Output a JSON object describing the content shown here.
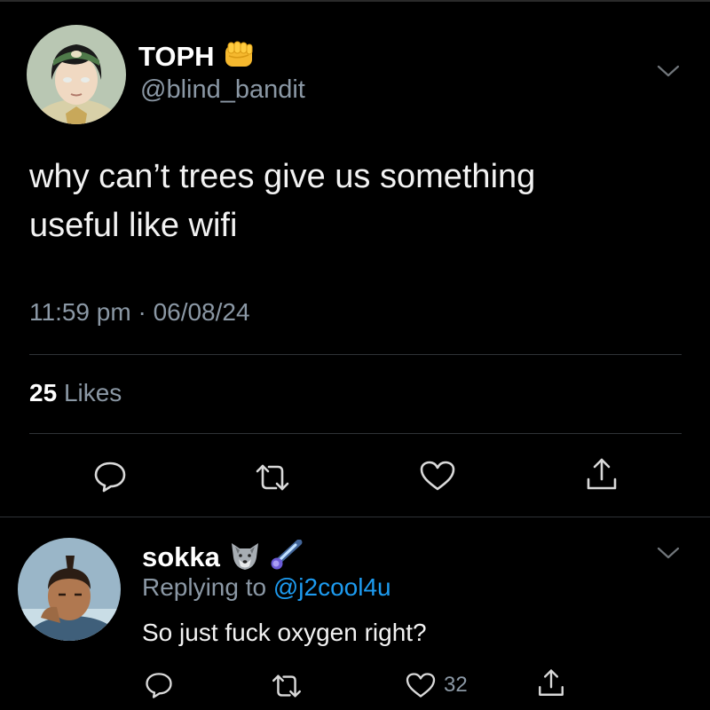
{
  "tweet": {
    "author_name": "TOPH",
    "author_emoji": "fist-emoji",
    "handle": "@blind_bandit",
    "text_line1": "why can’t trees give us something",
    "text_line2": "useful like wifi",
    "time": "11:59 pm",
    "separator": "·",
    "date": "06/08/24",
    "likes_count": "25",
    "likes_label": "Likes",
    "actions": [
      "reply-icon",
      "retweet-icon",
      "like-icon",
      "share-icon"
    ]
  },
  "reply": {
    "author_name": "sokka",
    "author_emojis": [
      "wolf-emoji",
      "comet-emoji"
    ],
    "replying_prefix": "Replying to",
    "replying_to": "@j2cool4u",
    "text": "So just fuck oxygen right?",
    "like_count": "32",
    "actions": [
      "reply-icon",
      "retweet-icon",
      "like-icon",
      "share-icon"
    ]
  },
  "colors": {
    "background": "#000000",
    "text": "#f2f2f2",
    "secondary": "#8b98a5",
    "mention": "#1d9bf0",
    "divider": "#2f3336"
  }
}
